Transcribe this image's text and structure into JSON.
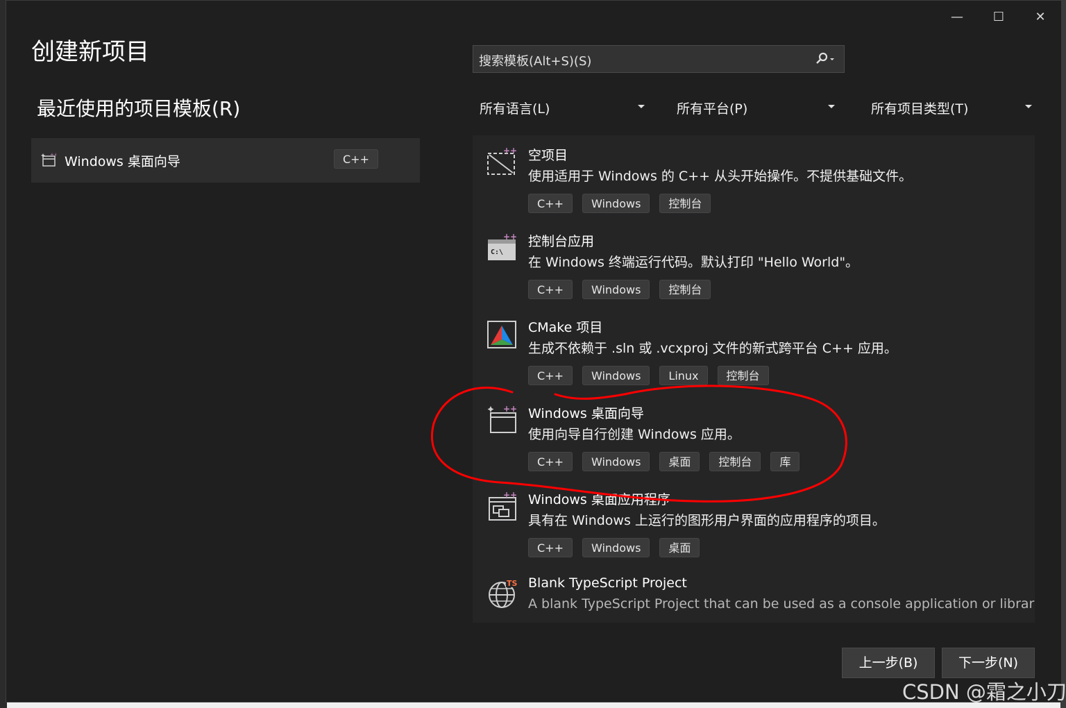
{
  "window": {
    "title": "创建新项目",
    "minimize_glyph": "—",
    "maximize_glyph": "☐",
    "close_glyph": "✕"
  },
  "recent": {
    "heading": "最近使用的项目模板(R)",
    "items": [
      {
        "label": "Windows 桌面向导",
        "tag": "C++",
        "icon": "wizard-icon"
      }
    ]
  },
  "search": {
    "placeholder": "搜索模板(Alt+S)(S)",
    "icon": "search-icon"
  },
  "filters": {
    "language": "所有语言(L)",
    "platform": "所有平台(P)",
    "project_type": "所有项目类型(T)"
  },
  "templates": [
    {
      "name": "空项目",
      "desc": "使用适用于 Windows 的 C++ 从头开始操作。不提供基础文件。",
      "tags": [
        "C++",
        "Windows",
        "控制台"
      ],
      "icon": "empty-project-icon"
    },
    {
      "name": "控制台应用",
      "desc": "在 Windows 终端运行代码。默认打印 \"Hello World\"。",
      "tags": [
        "C++",
        "Windows",
        "控制台"
      ],
      "icon": "console-app-icon"
    },
    {
      "name": "CMake 项目",
      "desc": "生成不依赖于 .sln 或 .vcxproj 文件的新式跨平台 C++ 应用。",
      "tags": [
        "C++",
        "Windows",
        "Linux",
        "控制台"
      ],
      "icon": "cmake-icon"
    },
    {
      "name": "Windows 桌面向导",
      "desc": "使用向导自行创建 Windows 应用。",
      "tags": [
        "C++",
        "Windows",
        "桌面",
        "控制台",
        "库"
      ],
      "icon": "wizard-icon"
    },
    {
      "name": "Windows 桌面应用程序",
      "desc": "具有在 Windows 上运行的图形用户界面的应用程序的项目。",
      "tags": [
        "C++",
        "Windows",
        "桌面"
      ],
      "icon": "desktop-app-icon"
    },
    {
      "name": "Blank TypeScript Project",
      "desc": "A blank TypeScript Project that can be used as a console application or library.",
      "tags": [],
      "icon": "typescript-globe-icon"
    }
  ],
  "buttons": {
    "back": "上一步(B)",
    "next": "下一步(N)"
  },
  "watermark": "CSDN @霜之小刀",
  "colors": {
    "accent_purple": "#c586c0",
    "annotation_red": "#ff0000",
    "background": "#1f1f1f",
    "list_bg": "#252526"
  }
}
